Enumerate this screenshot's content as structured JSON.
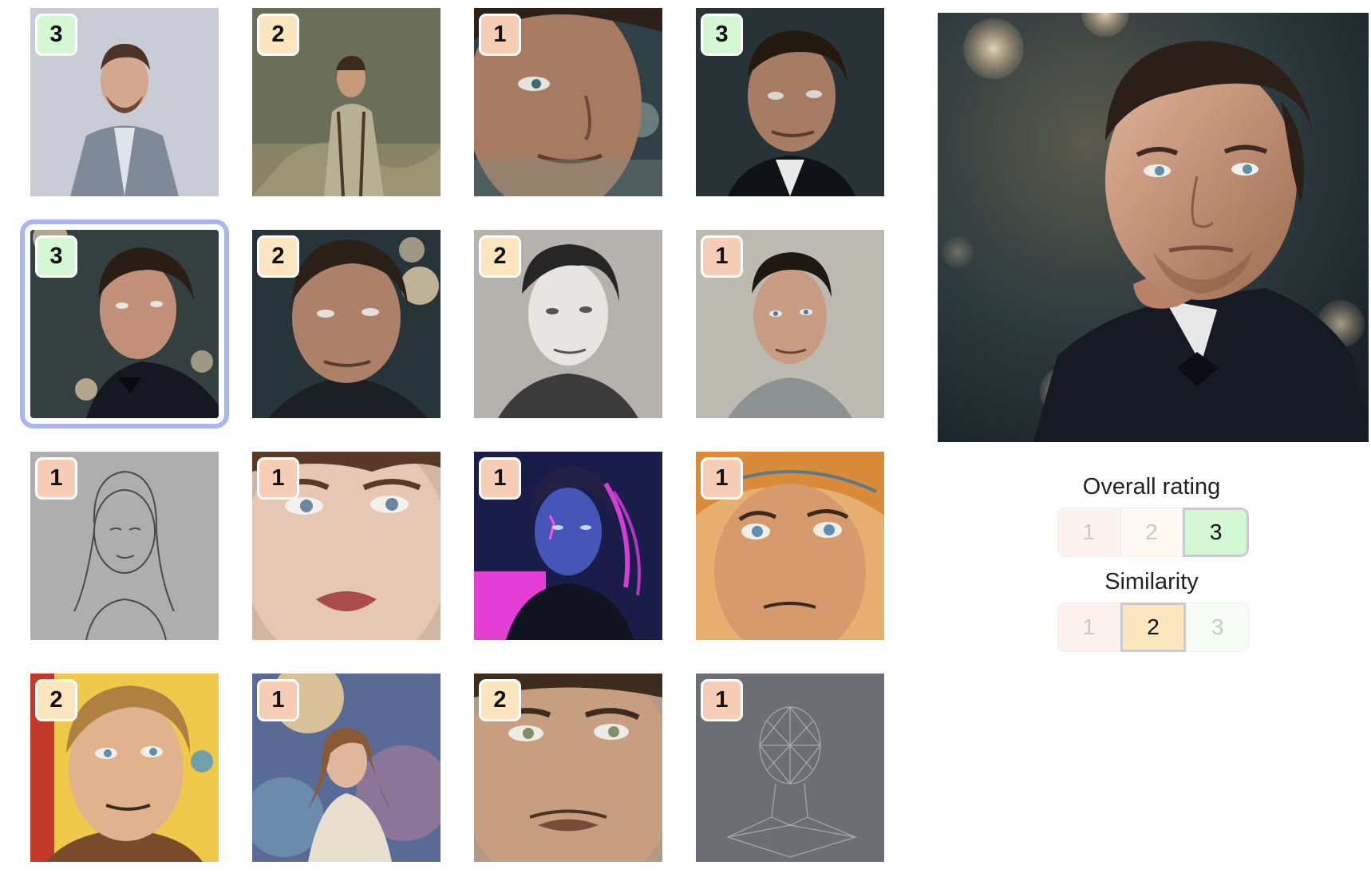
{
  "thumbnails": [
    {
      "name": "thumb-lowpoly-suit",
      "badge": "3",
      "level": "3",
      "selected": false
    },
    {
      "name": "thumb-hillside-suspenders",
      "badge": "2",
      "level": "2",
      "selected": false
    },
    {
      "name": "thumb-closeup-teal",
      "badge": "1",
      "level": "1",
      "selected": false
    },
    {
      "name": "thumb-dark-suit",
      "badge": "3",
      "level": "3",
      "selected": false
    },
    {
      "name": "thumb-tuxedo-bokeh",
      "badge": "3",
      "level": "3",
      "selected": true
    },
    {
      "name": "thumb-portrait-bokeh",
      "badge": "2",
      "level": "2",
      "selected": false
    },
    {
      "name": "thumb-bw-portrait",
      "badge": "2",
      "level": "2",
      "selected": false
    },
    {
      "name": "thumb-plain-portrait",
      "badge": "1",
      "level": "1",
      "selected": false
    },
    {
      "name": "thumb-pencil-sketch",
      "badge": "1",
      "level": "1",
      "selected": false
    },
    {
      "name": "thumb-face-closeup",
      "badge": "1",
      "level": "1",
      "selected": false
    },
    {
      "name": "thumb-cyberpunk",
      "badge": "1",
      "level": "1",
      "selected": false
    },
    {
      "name": "thumb-comic-turban",
      "badge": "1",
      "level": "1",
      "selected": false
    },
    {
      "name": "thumb-comic-portrait",
      "badge": "2",
      "level": "2",
      "selected": false
    },
    {
      "name": "thumb-cosmic-woman",
      "badge": "1",
      "level": "1",
      "selected": false
    },
    {
      "name": "thumb-extreme-closeup",
      "badge": "2",
      "level": "2",
      "selected": false
    },
    {
      "name": "thumb-wireframe-head",
      "badge": "1",
      "level": "1",
      "selected": false
    }
  ],
  "badge_colors": {
    "1": "#f7cdb6",
    "2": "#fbe6bf",
    "3": "#d4f7d4"
  },
  "preview": {
    "name": "preview-tuxedo-portrait"
  },
  "overall_rating": {
    "title": "Overall rating",
    "options": [
      {
        "label": "1",
        "level": "1"
      },
      {
        "label": "2",
        "level": "2"
      },
      {
        "label": "3",
        "level": "3"
      }
    ],
    "selected": "3"
  },
  "similarity": {
    "title": "Similarity",
    "options": [
      {
        "label": "1",
        "level": "1"
      },
      {
        "label": "2",
        "level": "2"
      },
      {
        "label": "3",
        "level": "3"
      }
    ],
    "selected": "2"
  },
  "segment_colors": {
    "active": {
      "1": "#f7cdb6",
      "2": "#fbe6bf",
      "3": "#d4f7d4"
    },
    "inactive": {
      "1": "#fdf3ee",
      "2": "#fefaf2",
      "3": "#f5fdf5"
    }
  }
}
